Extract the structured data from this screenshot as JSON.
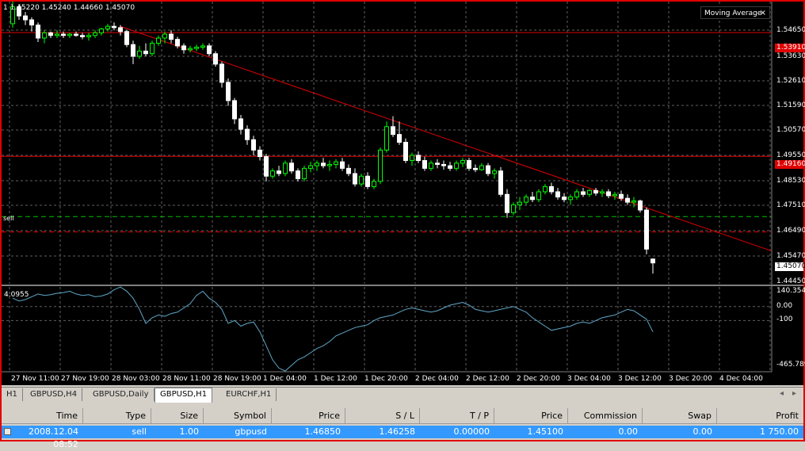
{
  "ohlc_readout": "1  1.45220 1.45240 1.44660 1.45070",
  "indicator_box": {
    "label": "Moving Average",
    "close_glyph": "×"
  },
  "price_axis": {
    "ticks": [
      "1.54650",
      "1.53630",
      "1.52610",
      "1.51590",
      "1.50570",
      "1.49550",
      "1.48530",
      "1.47510",
      "1.46490",
      "1.45470",
      "1.44450"
    ],
    "line_labels": {
      "upper": "1.53910",
      "middle": "1.49160"
    },
    "current_price": "1.45070"
  },
  "sell_label": "sell",
  "indicator_panel": {
    "value": "4.0955",
    "ticks": [
      "140.3549",
      "0.00",
      "-100",
      "-465.789"
    ]
  },
  "time_axis": [
    "27 Nov 11:00",
    "27 Nov 19:00",
    "28 Nov 03:00",
    "28 Nov 11:00",
    "28 Nov 19:00",
    "1 Dec 04:00",
    "1 Dec 12:00",
    "1 Dec 20:00",
    "2 Dec 04:00",
    "2 Dec 12:00",
    "2 Dec 20:00",
    "3 Dec 04:00",
    "3 Dec 12:00",
    "3 Dec 20:00",
    "4 Dec 04:00"
  ],
  "tabs": [
    "H1",
    "GBPUSD,H4",
    "GBPUSD,Daily",
    "GBPUSD,H1",
    "EURCHF,H1"
  ],
  "active_tab": "GBPUSD,H1",
  "scroll_arrows": {
    "left": "◂",
    "right": "▸"
  },
  "table": {
    "headers": [
      "Time",
      "Type",
      "Size",
      "Symbol",
      "Price",
      "S / L",
      "T / P",
      "Price",
      "Commission",
      "Swap",
      "Profit"
    ],
    "row": [
      "2008.12.04 08:52",
      "sell",
      "1.00",
      "gbpusd",
      "1.46850",
      "1.46258",
      "0.00000",
      "1.45100",
      "0.00",
      "0.00",
      "1 750.00"
    ]
  },
  "colors": {
    "bull": "#00ff00",
    "bear": "#ffffff",
    "trendline": "#e00000",
    "hline": "#e00000",
    "sell_line": "#00c000",
    "indicator": "#5fa8c8",
    "grid": "#606060"
  },
  "chart_data": {
    "type": "candlestick",
    "ylim": [
      1.4427,
      1.551
    ],
    "candles": [
      [
        1.5425,
        1.5515,
        1.541,
        1.549
      ],
      [
        1.549,
        1.55,
        1.544,
        1.5455
      ],
      [
        1.5455,
        1.547,
        1.542,
        1.544
      ],
      [
        1.544,
        1.545,
        1.5395,
        1.542
      ],
      [
        1.542,
        1.543,
        1.5355,
        1.537
      ],
      [
        1.537,
        1.54,
        1.535,
        1.539
      ],
      [
        1.539,
        1.5395,
        1.537,
        1.538
      ],
      [
        1.538,
        1.54,
        1.537,
        1.5385
      ],
      [
        1.5385,
        1.5395,
        1.537,
        1.538
      ],
      [
        1.538,
        1.539,
        1.537,
        1.5385
      ],
      [
        1.5385,
        1.5395,
        1.5375,
        1.538
      ],
      [
        1.538,
        1.539,
        1.5365,
        1.5375
      ],
      [
        1.5375,
        1.539,
        1.536,
        1.538
      ],
      [
        1.538,
        1.54,
        1.537,
        1.539
      ],
      [
        1.539,
        1.541,
        1.538,
        1.5405
      ],
      [
        1.5405,
        1.5425,
        1.5395,
        1.5415
      ],
      [
        1.5415,
        1.543,
        1.54,
        1.541
      ],
      [
        1.541,
        1.542,
        1.538,
        1.5395
      ],
      [
        1.5395,
        1.54,
        1.5335,
        1.5345
      ],
      [
        1.5345,
        1.536,
        1.527,
        1.53
      ],
      [
        1.53,
        1.534,
        1.529,
        1.532
      ],
      [
        1.532,
        1.535,
        1.53,
        1.531
      ],
      [
        1.531,
        1.536,
        1.53,
        1.535
      ],
      [
        1.535,
        1.538,
        1.534,
        1.537
      ],
      [
        1.537,
        1.5395,
        1.535,
        1.5385
      ],
      [
        1.5385,
        1.54,
        1.535,
        1.5365
      ],
      [
        1.5365,
        1.5375,
        1.533,
        1.534
      ],
      [
        1.534,
        1.535,
        1.531,
        1.5325
      ],
      [
        1.5325,
        1.534,
        1.5315,
        1.533
      ],
      [
        1.533,
        1.5345,
        1.532,
        1.5335
      ],
      [
        1.5335,
        1.535,
        1.5325,
        1.534
      ],
      [
        1.534,
        1.535,
        1.53,
        1.531
      ],
      [
        1.531,
        1.532,
        1.526,
        1.527
      ],
      [
        1.527,
        1.528,
        1.518,
        1.52
      ],
      [
        1.52,
        1.5215,
        1.511,
        1.513
      ],
      [
        1.513,
        1.514,
        1.504,
        1.506
      ],
      [
        1.506,
        1.5075,
        1.5,
        1.502
      ],
      [
        1.502,
        1.5035,
        1.496,
        1.498
      ],
      [
        1.498,
        1.4995,
        1.492,
        1.494
      ],
      [
        1.494,
        1.4955,
        1.49,
        1.4915
      ],
      [
        1.4915,
        1.4925,
        1.482,
        1.484
      ],
      [
        1.484,
        1.487,
        1.483,
        1.486
      ],
      [
        1.486,
        1.488,
        1.484,
        1.485
      ],
      [
        1.485,
        1.49,
        1.484,
        1.489
      ],
      [
        1.489,
        1.4905,
        1.485,
        1.486
      ],
      [
        1.486,
        1.487,
        1.482,
        1.483
      ],
      [
        1.483,
        1.488,
        1.482,
        1.487
      ],
      [
        1.487,
        1.4895,
        1.4855,
        1.488
      ],
      [
        1.488,
        1.49,
        1.486,
        1.489
      ],
      [
        1.489,
        1.491,
        1.487,
        1.488
      ],
      [
        1.488,
        1.49,
        1.486,
        1.4885
      ],
      [
        1.4885,
        1.4905,
        1.487,
        1.4895
      ],
      [
        1.4895,
        1.491,
        1.486,
        1.487
      ],
      [
        1.487,
        1.4885,
        1.484,
        1.485
      ],
      [
        1.485,
        1.487,
        1.48,
        1.481
      ],
      [
        1.481,
        1.485,
        1.48,
        1.484
      ],
      [
        1.484,
        1.4855,
        1.479,
        1.48
      ],
      [
        1.48,
        1.483,
        1.479,
        1.482
      ],
      [
        1.482,
        1.495,
        1.481,
        1.494
      ],
      [
        1.494,
        1.505,
        1.493,
        1.503
      ],
      [
        1.503,
        1.507,
        1.499,
        1.5
      ],
      [
        1.5,
        1.505,
        1.496,
        1.497
      ],
      [
        1.497,
        1.4985,
        1.489,
        1.49
      ],
      [
        1.49,
        1.493,
        1.488,
        1.492
      ],
      [
        1.492,
        1.4935,
        1.489,
        1.49
      ],
      [
        1.49,
        1.4915,
        1.486,
        1.487
      ],
      [
        1.487,
        1.49,
        1.486,
        1.489
      ],
      [
        1.489,
        1.4905,
        1.487,
        1.4885
      ],
      [
        1.4885,
        1.49,
        1.4865,
        1.488
      ],
      [
        1.488,
        1.4895,
        1.486,
        1.487
      ],
      [
        1.487,
        1.49,
        1.486,
        1.489
      ],
      [
        1.489,
        1.491,
        1.4875,
        1.49
      ],
      [
        1.49,
        1.491,
        1.486,
        1.487
      ],
      [
        1.487,
        1.4885,
        1.4855,
        1.4865
      ],
      [
        1.4865,
        1.489,
        1.486,
        1.488
      ],
      [
        1.488,
        1.489,
        1.484,
        1.485
      ],
      [
        1.485,
        1.487,
        1.483,
        1.486
      ],
      [
        1.486,
        1.4875,
        1.476,
        1.477
      ],
      [
        1.477,
        1.479,
        1.468,
        1.47
      ],
      [
        1.47,
        1.474,
        1.469,
        1.473
      ],
      [
        1.473,
        1.476,
        1.471,
        1.474
      ],
      [
        1.474,
        1.477,
        1.473,
        1.476
      ],
      [
        1.476,
        1.478,
        1.474,
        1.475
      ],
      [
        1.475,
        1.479,
        1.474,
        1.478
      ],
      [
        1.478,
        1.481,
        1.477,
        1.48
      ],
      [
        1.48,
        1.4815,
        1.477,
        1.478
      ],
      [
        1.478,
        1.4795,
        1.475,
        1.476
      ],
      [
        1.476,
        1.4775,
        1.474,
        1.475
      ],
      [
        1.475,
        1.477,
        1.473,
        1.476
      ],
      [
        1.476,
        1.479,
        1.475,
        1.478
      ],
      [
        1.478,
        1.4795,
        1.476,
        1.477
      ],
      [
        1.477,
        1.479,
        1.476,
        1.4785
      ],
      [
        1.4785,
        1.4795,
        1.4765,
        1.4775
      ],
      [
        1.4775,
        1.479,
        1.476,
        1.478
      ],
      [
        1.478,
        1.479,
        1.4755,
        1.4765
      ],
      [
        1.4765,
        1.478,
        1.475,
        1.477
      ],
      [
        1.477,
        1.4785,
        1.4745,
        1.4755
      ],
      [
        1.4755,
        1.477,
        1.473,
        1.474
      ],
      [
        1.474,
        1.476,
        1.472,
        1.4745
      ],
      [
        1.4745,
        1.475,
        1.47,
        1.471
      ],
      [
        1.471,
        1.472,
        1.454,
        1.456
      ],
      [
        1.4522,
        1.4524,
        1.4466,
        1.4507
      ]
    ],
    "trendline": [
      [
        1.5415,
        17
      ],
      [
        1.471,
        101
      ]
    ],
    "hlines": [
      1.5391,
      1.4916
    ],
    "sell_line": 1.4685,
    "dashed_line": 1.4626,
    "indicator_series": [
      60,
      40,
      50,
      70,
      90,
      80,
      85,
      95,
      100,
      110,
      90,
      80,
      85,
      70,
      75,
      90,
      120,
      140,
      110,
      60,
      -20,
      -120,
      -80,
      -60,
      -70,
      -50,
      -40,
      -10,
      20,
      80,
      110,
      60,
      30,
      -20,
      -120,
      -100,
      -140,
      -120,
      -110,
      -180,
      -280,
      -380,
      -440,
      -460,
      -420,
      -380,
      -360,
      -330,
      -300,
      -280,
      -250,
      -210,
      -190,
      -170,
      -150,
      -140,
      -130,
      -100,
      -80,
      -70,
      -60,
      -40,
      -20,
      -10,
      -20,
      -30,
      -40,
      -30,
      -10,
      10,
      20,
      30,
      10,
      -20,
      -30,
      -40,
      -30,
      -20,
      -10,
      0,
      -20,
      -40,
      -80,
      -110,
      -140,
      -170,
      -160,
      -150,
      -140,
      -120,
      -110,
      -120,
      -100,
      -80,
      -70,
      -60,
      -40,
      -20,
      -30,
      -60,
      -90,
      -180
    ]
  }
}
